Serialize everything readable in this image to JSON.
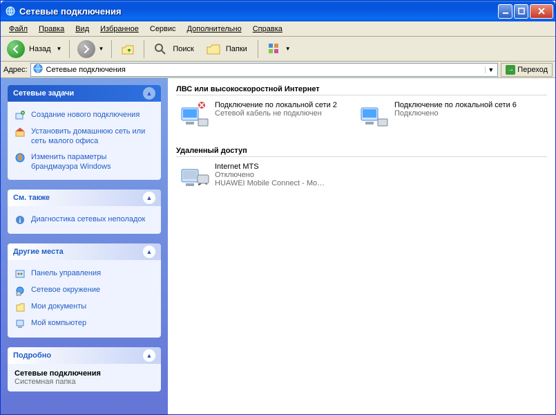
{
  "window": {
    "title": "Сетевые подключения"
  },
  "menu": {
    "file": "Файл",
    "edit": "Правка",
    "view": "Вид",
    "favorites": "Избранное",
    "tools": "Сервис",
    "advanced": "Дополнительно",
    "help": "Справка"
  },
  "toolbar": {
    "back": "Назад",
    "search": "Поиск",
    "folders": "Папки"
  },
  "address": {
    "label": "Адрес:",
    "value": "Сетевые подключения",
    "go": "Переход"
  },
  "sidebar": {
    "tasks": {
      "title": "Сетевые задачи",
      "items": [
        "Создание нового подключения",
        "Установить домашнюю сеть или сеть малого офиса",
        "Изменить параметры брандмауэра Windows"
      ]
    },
    "seealso": {
      "title": "См. также",
      "items": [
        "Диагностика сетевых неполадок"
      ]
    },
    "places": {
      "title": "Другие места",
      "items": [
        "Панель управления",
        "Сетевое окружение",
        "Мои документы",
        "Мой компьютер"
      ]
    },
    "details": {
      "title": "Подробно",
      "name": "Сетевые подключения",
      "type": "Системная папка"
    }
  },
  "content": {
    "group_lan": "ЛВС или высокоскоростной Интернет",
    "group_dialup": "Удаленный доступ",
    "lan": [
      {
        "name": "Подключение по локальной сети 2",
        "status": "Сетевой кабель не подключен"
      },
      {
        "name": "Подключение по локальной сети 6",
        "status": "Подключено"
      }
    ],
    "dialup": [
      {
        "name": "Internet MTS",
        "status": "Отключено",
        "device": "HUAWEI Mobile Connect - Mo…"
      }
    ]
  }
}
